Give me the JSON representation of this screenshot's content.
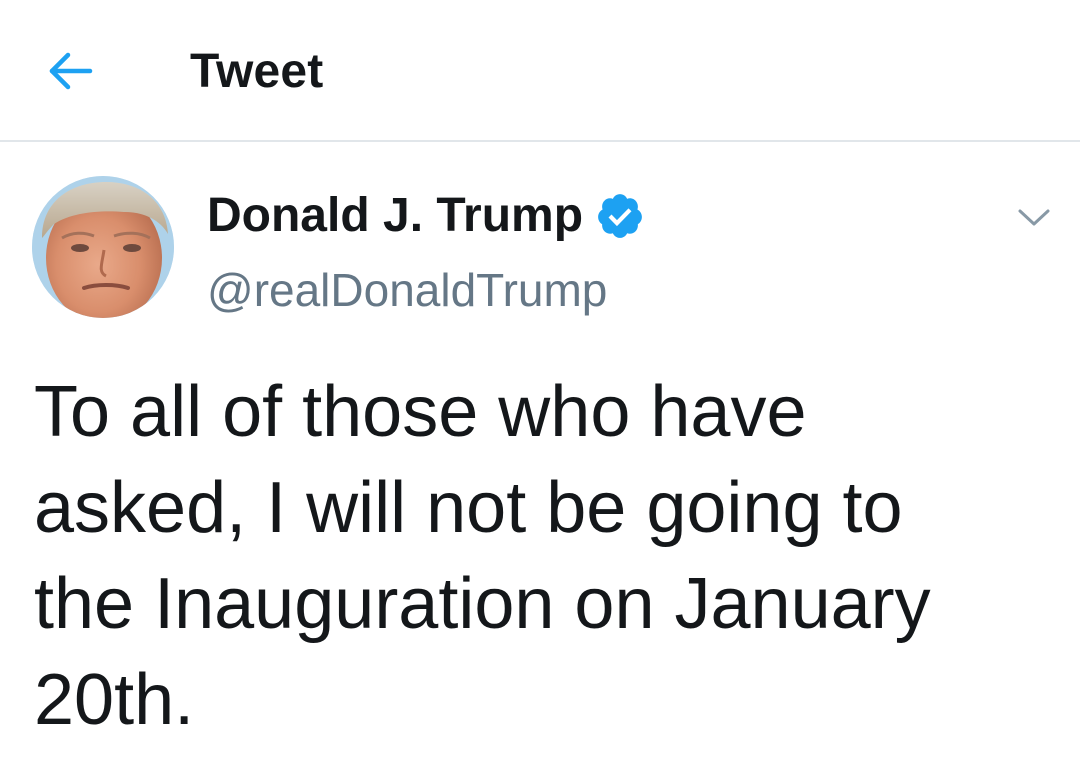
{
  "header": {
    "title": "Tweet",
    "back_icon": "arrow-left-icon",
    "accent_color": "#1da1f2"
  },
  "tweet": {
    "author": {
      "display_name": "Donald J. Trump",
      "handle": "@realDonaldTrump",
      "verified": true,
      "verified_icon": "verified-badge-icon",
      "avatar": "avatar-photo"
    },
    "menu_icon": "chevron-down-icon",
    "lines": [
      "To all of those who have",
      "asked, I will not be going to",
      "the Inauguration on January",
      "20th."
    ]
  }
}
